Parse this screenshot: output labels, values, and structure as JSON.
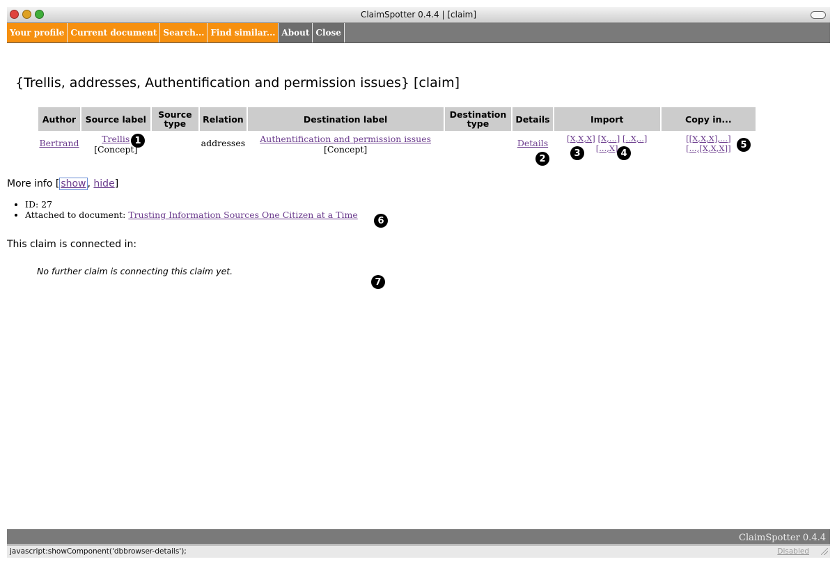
{
  "window": {
    "title": "ClaimSpotter 0.4.4 | [claim]"
  },
  "menu": {
    "your_profile": "Your profile",
    "current_document": "Current document",
    "search": "Search...",
    "find_similar": "Find similar...",
    "about": "About",
    "close": "Close"
  },
  "page": {
    "title": "{Trellis, addresses, Authentification and permission issues} [claim]"
  },
  "table": {
    "headers": {
      "author": "Author",
      "source_label": "Source label",
      "source_type": "Source type",
      "relation": "Relation",
      "destination_label": "Destination label",
      "destination_type": "Destination type",
      "details": "Details",
      "import": "Import",
      "copy_in": "Copy in..."
    },
    "row": {
      "author": "Bertrand",
      "source_label": "Trellis",
      "source_kind": "[Concept]",
      "relation": "addresses",
      "destination_label": "Authentification and permission issues",
      "destination_kind": "[Concept]",
      "details": "Details",
      "import_xxx": "[X,X,X]",
      "import_x_dots": "[X,...]",
      "import_dx": "[..X,..]",
      "import_dots_x": "[...,X]",
      "copy_1": "[[X,X,X],...]",
      "copy_2": "[...,[X,X,X]]"
    }
  },
  "more_info": {
    "label": "More info [",
    "show": "show",
    "sep": ", ",
    "hide": "hide",
    "end": "]"
  },
  "info": {
    "id": "ID: 27",
    "attached_label": "Attached to document: ",
    "attached_doc": "Trusting Information Sources One Citizen at a Time"
  },
  "connected": {
    "heading": "This claim is connected in:",
    "empty": "No further claim is connecting this claim yet."
  },
  "badges": {
    "b1": "1",
    "b2": "2",
    "b3": "3",
    "b4": "4",
    "b5": "5",
    "b6": "6",
    "b7": "7"
  },
  "footer": {
    "app": "ClaimSpotter 0.4.4"
  },
  "status": {
    "text": "javascript:showComponent('dbbrowser-details');",
    "disabled": "Disabled"
  }
}
